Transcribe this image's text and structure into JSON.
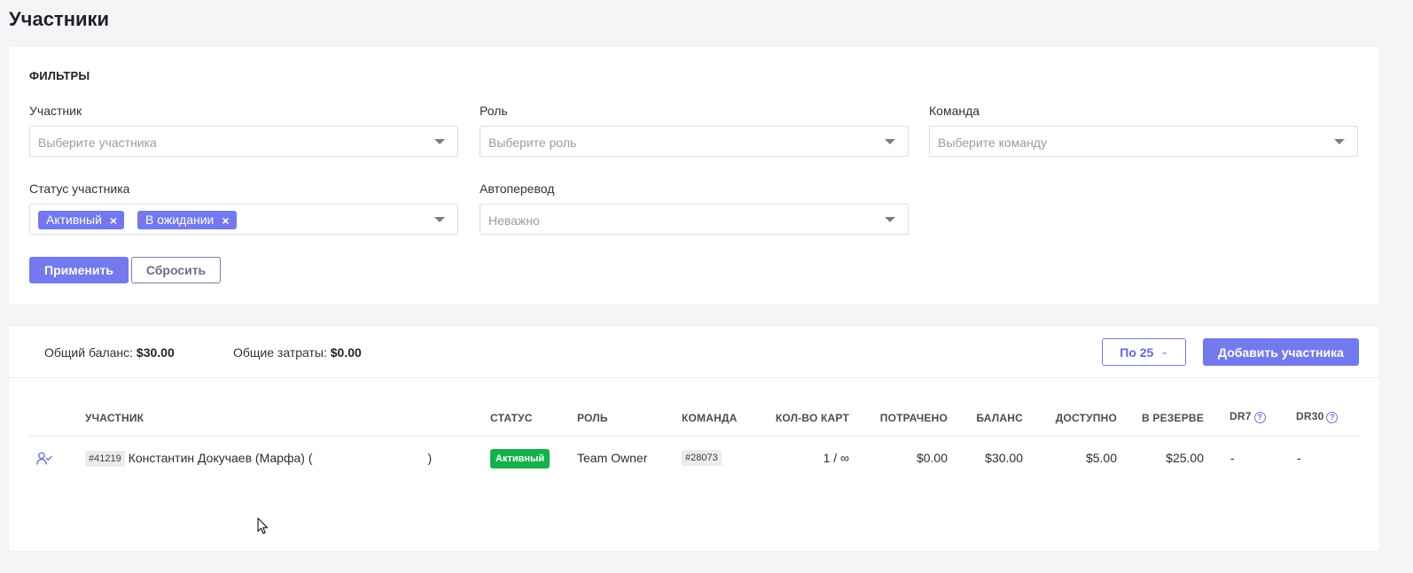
{
  "page": {
    "title": "Участники"
  },
  "filters": {
    "title": "ФИЛЬТРЫ",
    "participant": {
      "label": "Участник",
      "placeholder": "Выберите участника"
    },
    "role": {
      "label": "Роль",
      "placeholder": "Выберите роль"
    },
    "team": {
      "label": "Команда",
      "placeholder": "Выберите команду"
    },
    "status": {
      "label": "Статус участника",
      "tags": [
        "Активный",
        "В ожидании"
      ],
      "tag_remove": "×"
    },
    "autotransfer": {
      "label": "Автоперевод",
      "value": "Неважно"
    },
    "apply_label": "Применить",
    "reset_label": "Сбросить"
  },
  "summary": {
    "balance_label": "Общий баланс:",
    "balance_value": "$30.00",
    "spent_label": "Общие затраты:",
    "spent_value": "$0.00",
    "per_page_label": "По 25",
    "add_label": "Добавить участника"
  },
  "table": {
    "columns": [
      "УЧАСТНИК",
      "СТАТУС",
      "РОЛЬ",
      "КОМАНДА",
      "КОЛ-ВО КАРТ",
      "ПОТРАЧЕНО",
      "БАЛАНС",
      "ДОСТУПНО",
      "В РЕЗЕРВЕ",
      "DR7",
      "DR30"
    ],
    "help_glyph": "?",
    "rows": [
      {
        "id": "#41219",
        "name": "Константин Докучаев (Марфа) (",
        "name_close": ")",
        "status": "Активный",
        "role": "Team Owner",
        "team": "#28073",
        "cards": "1 / ∞",
        "spent": "$0.00",
        "balance": "$30.00",
        "available": "$5.00",
        "reserve": "$25.00",
        "dr7": "-",
        "dr30": "-"
      }
    ]
  },
  "colors": {
    "accent": "#7479ee",
    "active_badge": "#14b04c"
  }
}
